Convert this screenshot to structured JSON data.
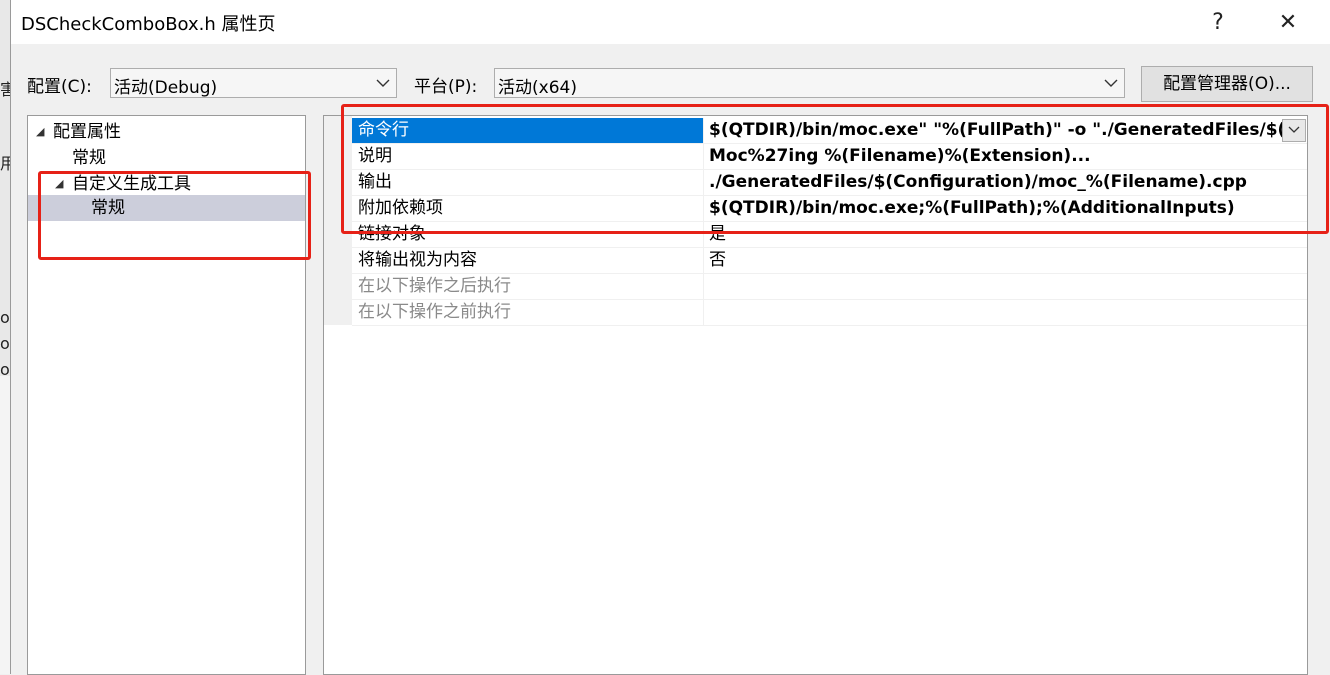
{
  "background": {
    "glyphs": [
      "害",
      "用",
      "ox",
      "o",
      "o"
    ]
  },
  "window": {
    "title": "DSCheckComboBox.h 属性页",
    "help_label": "?",
    "close_label": "✕"
  },
  "config": {
    "label": "配置(C):",
    "value": "活动(Debug)"
  },
  "platform": {
    "label": "平台(P):",
    "value": "活动(x64)"
  },
  "config_manager_label": "配置管理器(O)...",
  "tree": {
    "items": [
      {
        "label": "配置属性",
        "expand": "◢"
      },
      {
        "label": "常规"
      },
      {
        "label": "自定义生成工具",
        "expand": "◢"
      },
      {
        "label": "常规",
        "selected": true
      }
    ]
  },
  "properties": {
    "rows": [
      {
        "name": "命令行",
        "value": "$(QTDIR)/bin/moc.exe\" \"%(FullPath)\" -o \"./GeneratedFiles/$(Co",
        "selected": true
      },
      {
        "name": "说明",
        "value": "Moc%27ing %(Filename)%(Extension)..."
      },
      {
        "name": "输出",
        "value": "./GeneratedFiles/$(Configuration)/moc_%(Filename).cpp"
      },
      {
        "name": "附加依赖项",
        "value": "$(QTDIR)/bin/moc.exe;%(FullPath);%(AdditionalInputs)"
      },
      {
        "name": "链接对象",
        "value": "是"
      },
      {
        "name": "将输出视为内容",
        "value": "否"
      },
      {
        "name": "在以下操作之后执行",
        "value": "",
        "disabled": true
      },
      {
        "name": "在以下操作之前执行",
        "value": "",
        "disabled": true
      }
    ]
  },
  "colors": {
    "selection": "#0078d7",
    "tree_selection": "#cccedb",
    "annotation": "#e62117"
  }
}
